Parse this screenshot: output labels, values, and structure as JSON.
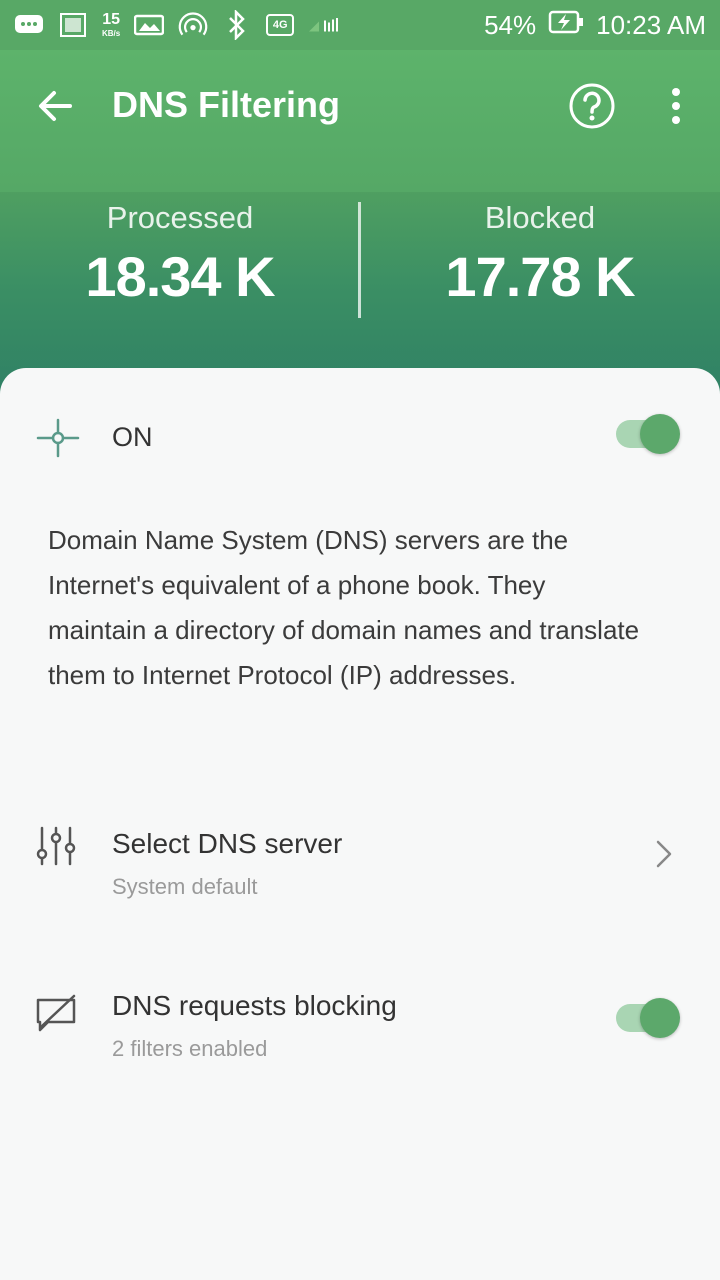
{
  "status_bar": {
    "data_speed_top": "15",
    "data_speed_bottom": "KB/s",
    "network_badge": "4G",
    "battery_percent": "54%",
    "time": "10:23 AM"
  },
  "toolbar": {
    "title": "DNS Filtering"
  },
  "stats": {
    "processed_label": "Processed",
    "processed_value": "18.34 K",
    "blocked_label": "Blocked",
    "blocked_value": "17.78 K"
  },
  "dns": {
    "toggle_label": "ON",
    "enabled": true,
    "description": "Domain Name System (DNS) servers are the Internet's equivalent of a phone book. They maintain a directory of domain names and translate them to Internet Protocol (IP) addresses.",
    "server_title": "Select DNS server",
    "server_subtitle": "System default",
    "blocking_title": "DNS requests blocking",
    "blocking_subtitle": "2 filters enabled",
    "blocking_enabled": true
  },
  "colors": {
    "primary": "#5db36b",
    "stats_dark": "#2f8065",
    "switch_thumb": "#5ca86b",
    "switch_track": "#a9d5b3"
  },
  "icons": [
    "message-icon",
    "image-icon",
    "gallery-icon",
    "hotspot-icon",
    "bluetooth-icon",
    "signal-icon",
    "battery-charging-icon",
    "back-arrow-icon",
    "help-icon",
    "more-vert-icon",
    "dns-node-icon",
    "equalizer-icon",
    "chevron-right-icon",
    "blocked-message-icon"
  ]
}
